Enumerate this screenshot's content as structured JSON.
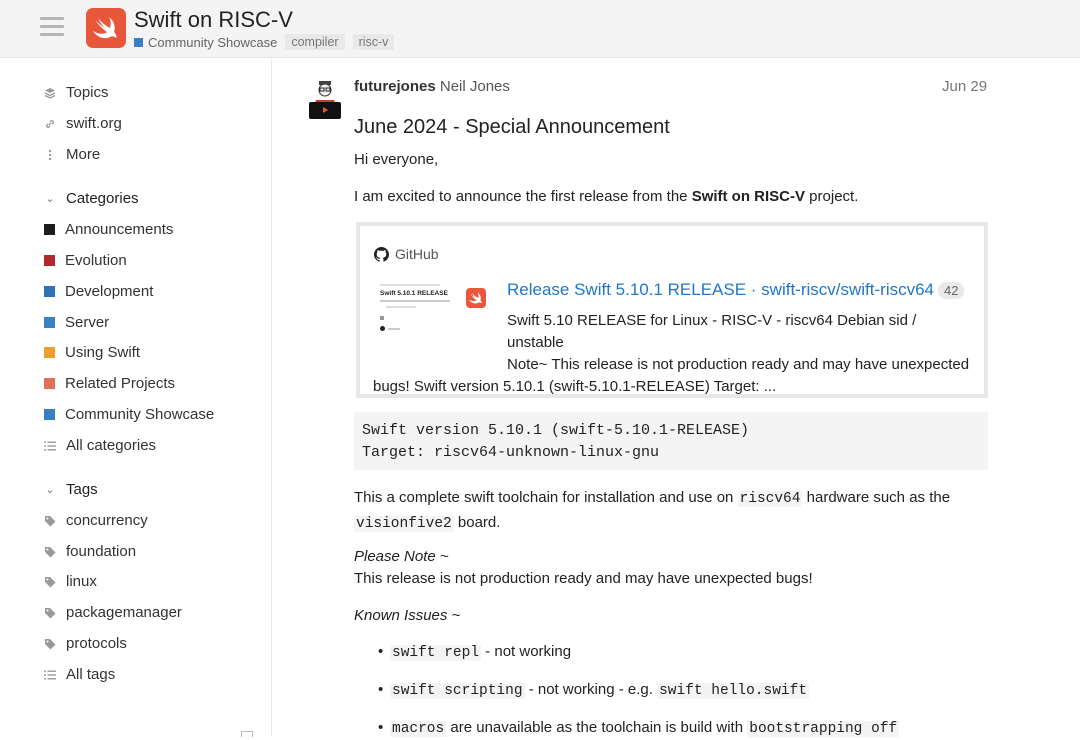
{
  "header": {
    "title": "Swift on RISC-V",
    "category": "Community Showcase",
    "category_color": "#3a7fc1",
    "tags": [
      "compiler",
      "risc-v"
    ],
    "brand_color": "#e8573a"
  },
  "sidebar": {
    "top_items": [
      {
        "label": "Topics",
        "icon": "layers-icon"
      },
      {
        "label": "swift.org",
        "icon": "link-icon"
      },
      {
        "label": "More",
        "icon": "ellipsis-vertical-icon"
      }
    ],
    "categories_heading": "Categories",
    "categories": [
      {
        "label": "Announcements",
        "color": "#1d1d1d"
      },
      {
        "label": "Evolution",
        "color": "#b3282d"
      },
      {
        "label": "Development",
        "color": "#2f72b5"
      },
      {
        "label": "Server",
        "color": "#3a82c4"
      },
      {
        "label": "Using Swift",
        "color": "#ef9d2e"
      },
      {
        "label": "Related Projects",
        "color": "#e0705a"
      },
      {
        "label": "Community Showcase",
        "color": "#3a7fc1"
      }
    ],
    "all_categories": "All categories",
    "tags_heading": "Tags",
    "tags": [
      "concurrency",
      "foundation",
      "linux",
      "packagemanager",
      "protocols"
    ],
    "all_tags": "All tags"
  },
  "post": {
    "username": "futurejones",
    "fullname": "Neil Jones",
    "date": "Jun 29",
    "heading": "June 2024 - Special Announcement",
    "greeting": "Hi everyone,",
    "intro_pre": "I am excited to announce the first release from the ",
    "intro_bold": "Swift on RISC-V",
    "intro_post": " project.",
    "onebox": {
      "source": "GitHub",
      "title": "Release Swift 5.10.1 RELEASE · swift-riscv/swift-riscv64",
      "count": "42",
      "thumb_title": "Swift 5.10.1 RELEASE",
      "desc_line1": "Swift 5.10 RELEASE for Linux - RISC-V - riscv64 Debian sid / unstable",
      "desc_line2": "Note~ This release is not production ready and may have unexpected",
      "desc_line3": "bugs! Swift version 5.10.1 (swift-5.10.1-RELEASE) Target: ..."
    },
    "code_line1": "Swift version 5.10.1 (swift-5.10.1-RELEASE)",
    "code_line2": "Target: riscv64-unknown-linux-gnu",
    "toolchain_pre": "This a complete swift toolchain for installation and use on ",
    "toolchain_code1": "riscv64",
    "toolchain_mid": " hardware such as the",
    "toolchain_code2": "visionfive2",
    "toolchain_post": " board.",
    "note_heading": "Please Note ~",
    "note_text": "This release is not production ready and may have unexpected bugs!",
    "issues_heading": "Known Issues ~",
    "issue1_code": "swift repl",
    "issue1_text": " - not working",
    "issue2_code": "swift scripting",
    "issue2_text": " - not working - e.g. ",
    "issue2_code2": "swift hello.swift",
    "issue3_code": "macros",
    "issue3_text": " are unavailable as the toolchain is build with ",
    "issue3_code2": "bootstrapping off"
  }
}
